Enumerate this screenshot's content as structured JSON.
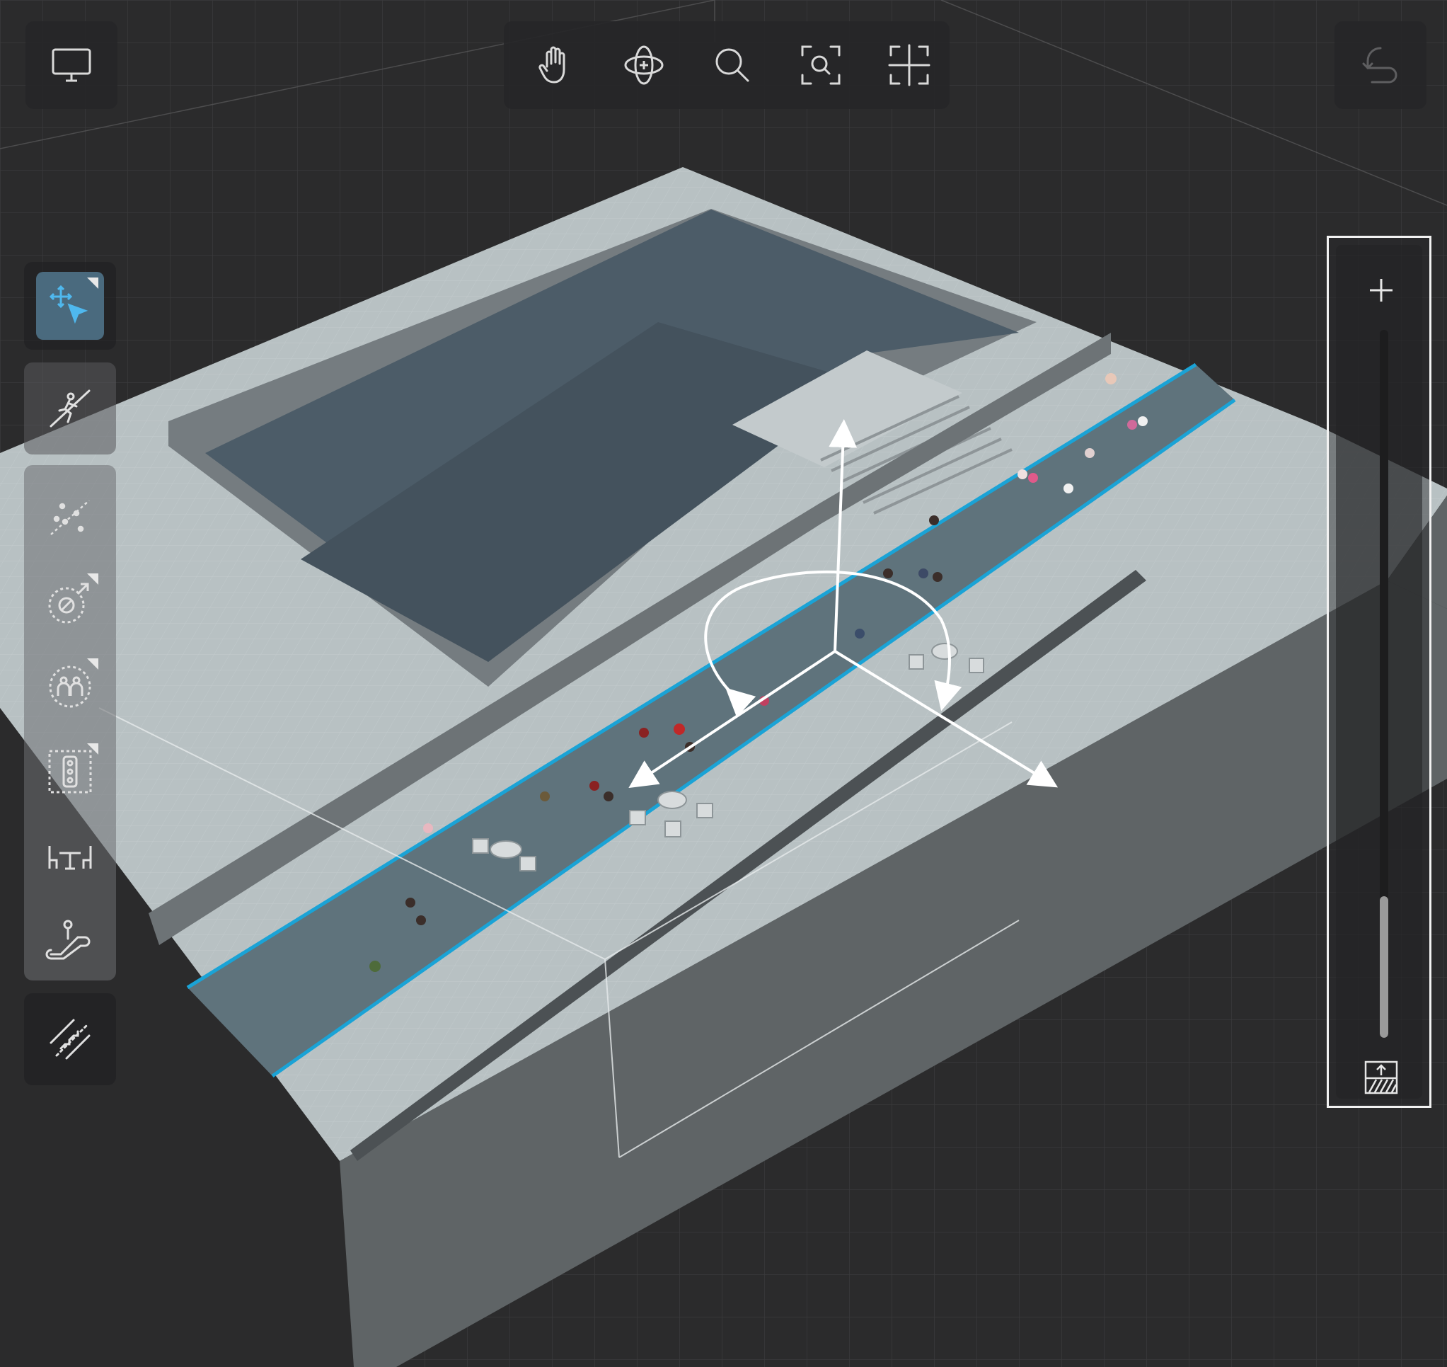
{
  "toolbar": {
    "display_button": {
      "icon": "monitor-icon"
    },
    "view_tools": [
      {
        "name": "pan",
        "icon": "hand-icon"
      },
      {
        "name": "orbit",
        "icon": "orbit-icon"
      },
      {
        "name": "zoom",
        "icon": "magnifier-icon"
      },
      {
        "name": "zoom-to-selection",
        "icon": "zoom-frame-icon"
      },
      {
        "name": "frame-all",
        "icon": "frame-all-icon"
      }
    ],
    "undo_button": {
      "icon": "undo-icon"
    }
  },
  "sidebar": {
    "tools": [
      {
        "name": "move-select",
        "icon": "move-select-icon",
        "active": true
      },
      {
        "name": "walkway",
        "icon": "walkway-icon"
      },
      {
        "name": "scatter-path",
        "icon": "scatter-path-icon"
      },
      {
        "name": "no-entry-zone",
        "icon": "no-entry-zone-icon"
      },
      {
        "name": "crowd-group",
        "icon": "crowd-group-icon"
      },
      {
        "name": "traffic-signal",
        "icon": "traffic-signal-icon"
      },
      {
        "name": "furniture",
        "icon": "table-chairs-icon"
      },
      {
        "name": "escalator",
        "icon": "escalator-icon"
      },
      {
        "name": "stairs-measure",
        "icon": "stairs-measure-icon"
      }
    ]
  },
  "level_panel": {
    "add_icon": "plus-icon",
    "level_value": 0.2,
    "floor_icon": "floor-up-icon"
  },
  "colors": {
    "background": "#2b2b2c",
    "floor": "#b9c3c5",
    "pool": "#4b5b67",
    "walkway": "#5c707a",
    "walkway_edge": "#1aa3d6",
    "active_tool": "#4a6a7e",
    "icon": "#d9d9d9"
  }
}
